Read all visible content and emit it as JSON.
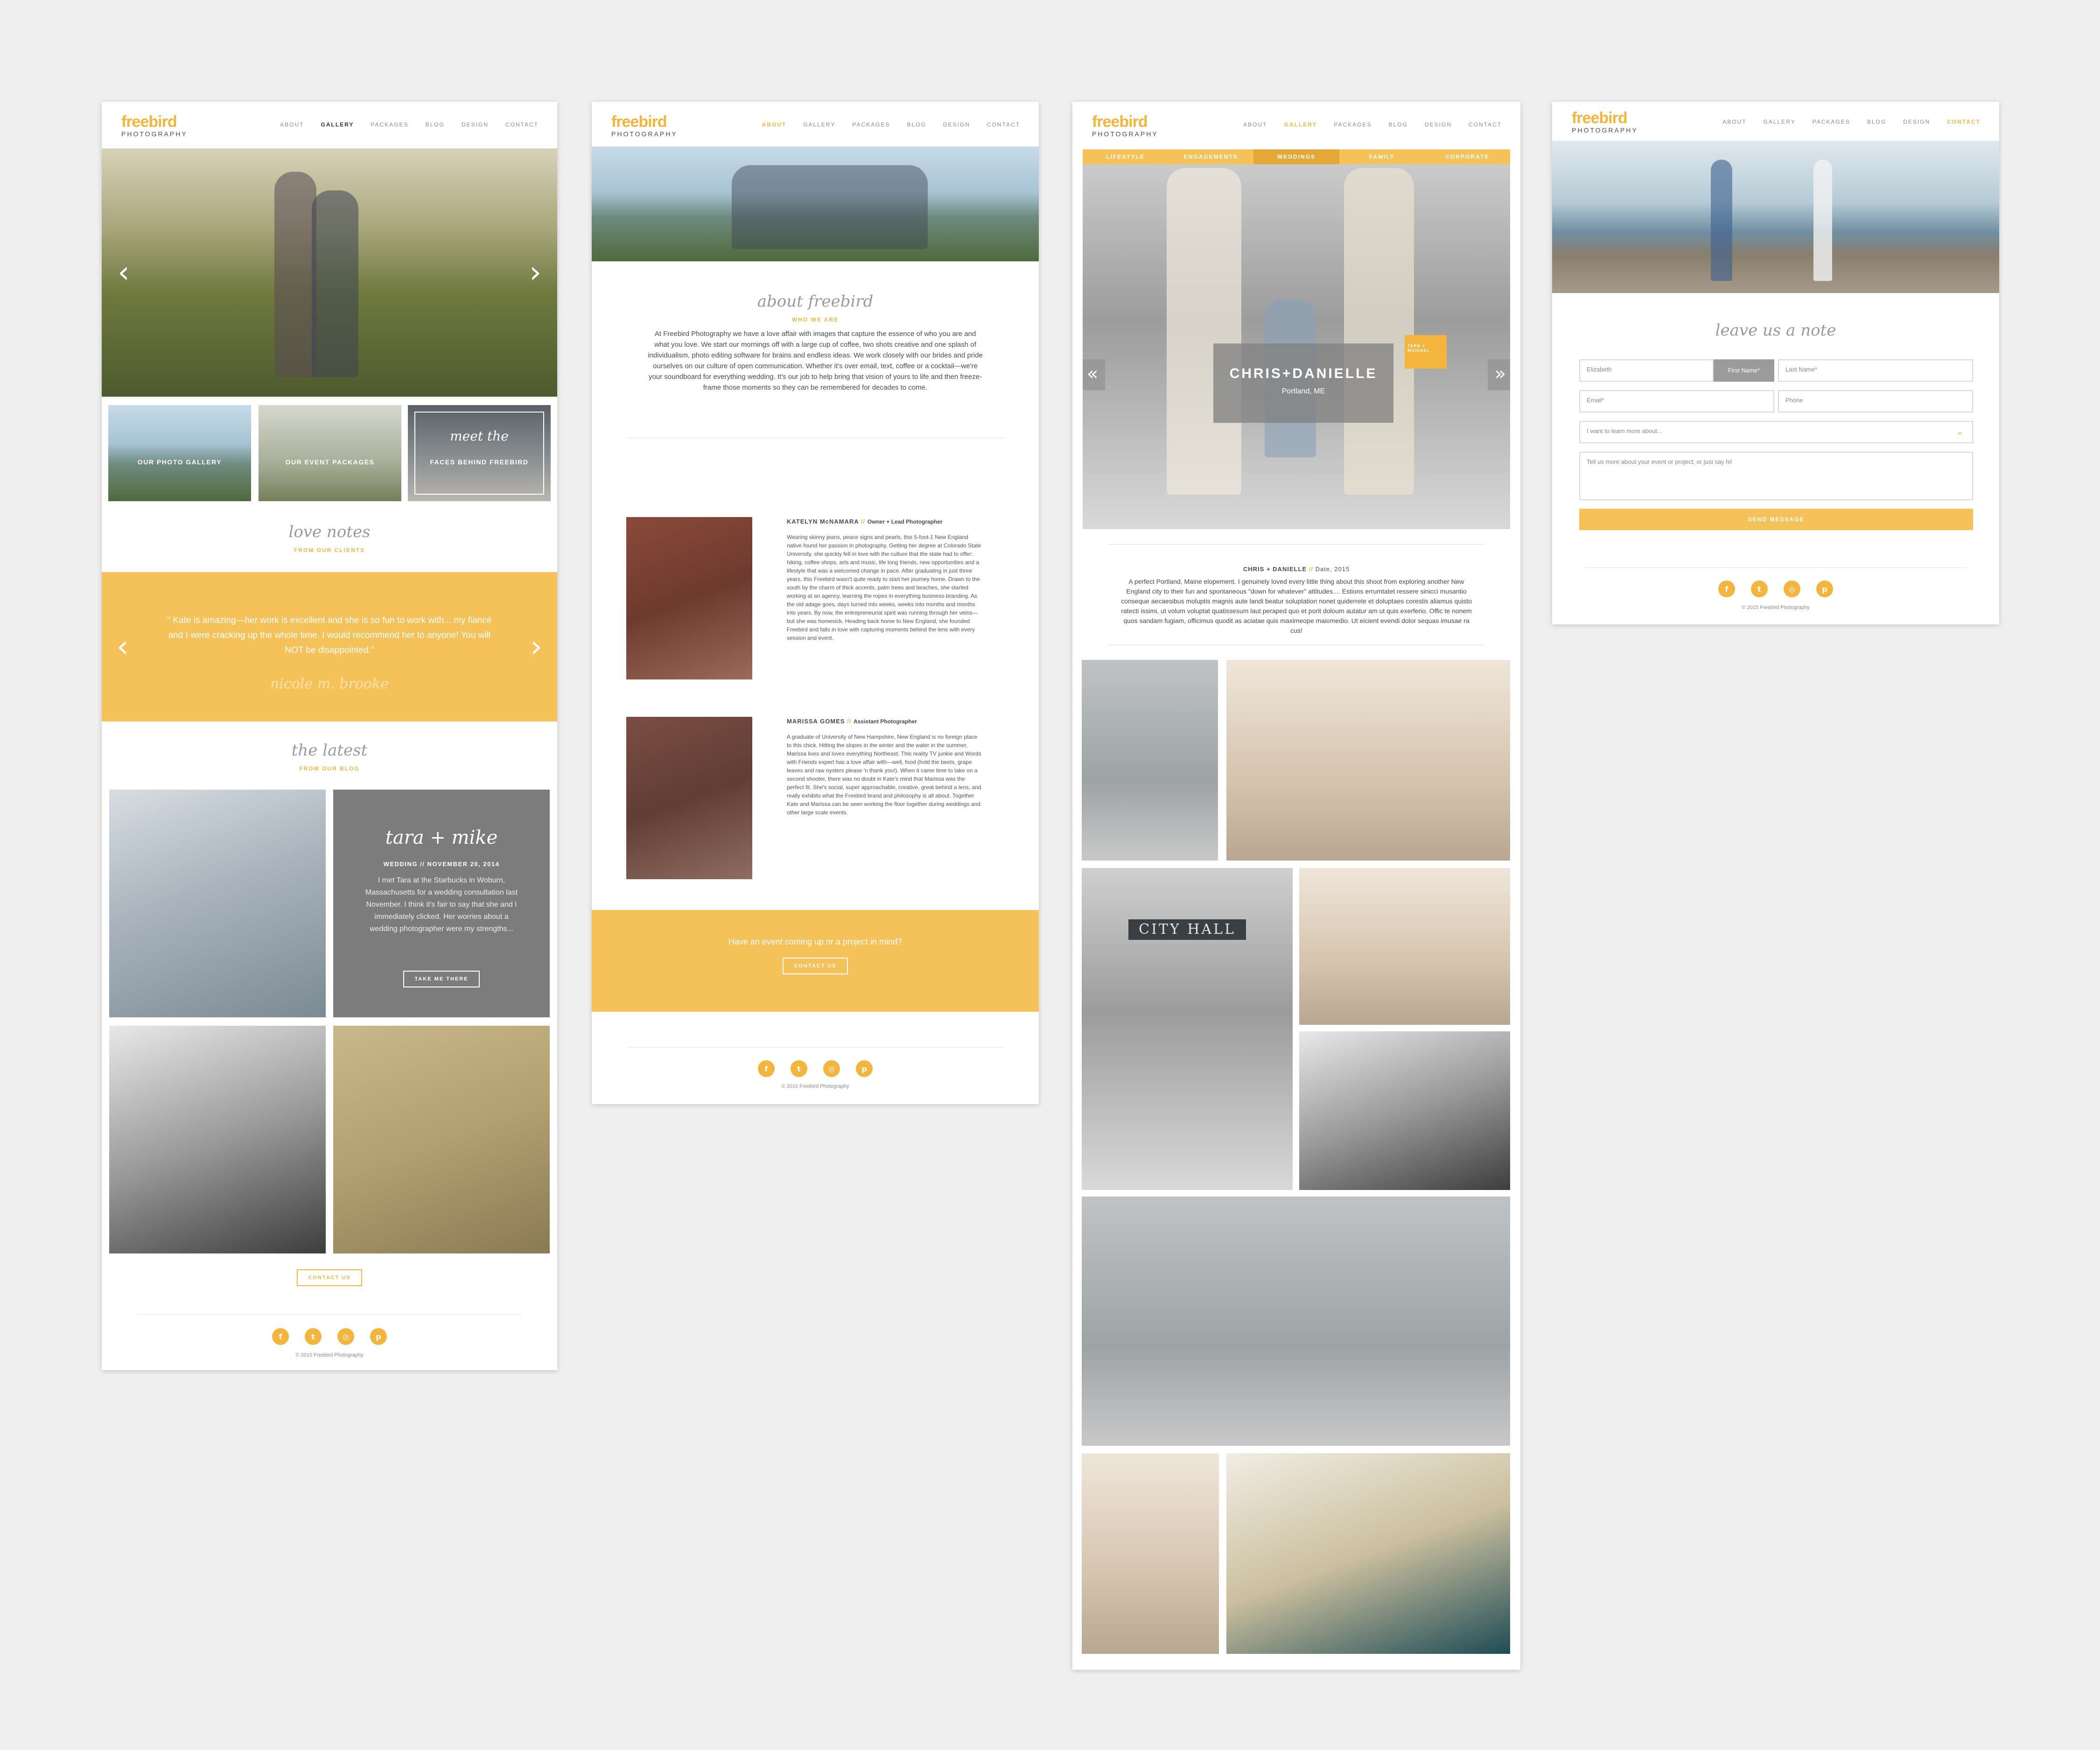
{
  "nav": {
    "logo_word": "freebird",
    "logo_sub": "PHOTOGRAPHY",
    "items": [
      "ABOUT",
      "GALLERY",
      "PACKAGES",
      "BLOG",
      "DESIGN",
      "CONTACT"
    ]
  },
  "home": {
    "tiles": [
      "OUR PHOTO GALLERY",
      "OUR EVENT PACKAGES",
      "FACES BEHIND FREEBIRD"
    ],
    "tile_scripts": [
      "",
      "",
      "meet the"
    ],
    "love_notes_script": "love notes",
    "love_notes_sub": "FROM OUR CLIENTS",
    "testimonial": "\" Kate is amazing—her work is excellent and she is so fun to work with... my fiancé and I were cracking up the whole time. I would recommend her to anyone! You will NOT be disappointed.\"",
    "testimonial_sig": "nicole m. brooke",
    "latest_script": "the latest",
    "latest_sub": "FROM OUR BLOG",
    "blog_post_script": "tara + mike",
    "blog_meta": "WEDDING // NOVEMBER 20, 2014",
    "blog_excerpt": "I met Tara at the Starbucks in Woburn, Massachusetts for a wedding consultation last November. I think it's fair to say that she and I immediately clicked. Her worries about a wedding photographer were my strengths...",
    "blog_button": "TAKE ME THERE",
    "contact_button": "CONTACT US",
    "copyright": "© 2015 Freebird Photography"
  },
  "about": {
    "script_title": "about freebird",
    "sub": "WHO WE ARE",
    "intro": "At Freebird Photography we have a love affair with images that capture the essence of who you are and what you love. We start our mornings off with a large cup of coffee, two shots creative and one splash of individualism, photo editing software for brains and endless ideas. We work closely with our brides and pride ourselves on our culture of open communication. Whether it's over email, text, coffee or a cocktail—we're your soundboard for everything wedding. It's our job to help bring that vision of yours to life and then freeze-frame those moments so they can be remembered for decades to come.",
    "person1_name": "KATELYN McNAMARA",
    "person1_role": "Owner + Lead Photographer",
    "person1_bio": "Wearing skinny jeans, peace signs and pearls, this 5-foot-1 New England native found her passion in photography. Getting her degree at Colorado State University, she quickly fell in love with the culture that the state had to offer: hiking, coffee shops, arts and music, life long friends, new opportunities and a lifestyle that was a welcomed change in pace. After graduating in just three years, this Freebird wasn't quite ready to start her journey home. Drawn to the south by the charm of thick accents, palm trees and beaches, she started working at an agency, learning the ropes in everything business-branding. As the old adage goes, days turned into weeks, weeks into months and months into years. By now, the entrepreneurial spirit was running through her veins—but she was homesick. Heading back home to New England, she founded Freebird and falls in love with capturing moments behind the lens with every session and event.",
    "person2_name": "MARISSA GOMES",
    "person2_role": "Assistant Photographer",
    "person2_bio": "A graduate of University of New Hampshire, New England is no foreign place to this chick. Hitting the slopes in the winter and the water in the summer, Marissa lives and loves everything Northeast. This reality TV junkie and Words with Friends expert has a love affair with—well, food (hold the beets, grape leaves and raw oysters please 'n thank you!). When it came time to take on a second shooter, there was no doubt in Kate's mind that Marissa was the perfect fit. She's social, super approachable, creative, great behind a lens, and really exhibits what the Freebird brand and philosophy is all about. Together Kate and Marissa can be seen working the floor together during weddings and other large scale events.",
    "cta_text": "Have an event coming up or a project in mind?",
    "cta_button": "CONTACT US",
    "copyright": "© 2015 Freebird Photography"
  },
  "gallery": {
    "tabs": [
      "LIFESTYLE",
      "ENGAGEMENTS",
      "WEDDINGS",
      "FAMILY",
      "CORPORATE"
    ],
    "active_tab": "WEDDINGS",
    "feature_title": "CHRIS+DANIELLE",
    "feature_location": "Portland, ME",
    "next_label": "TARA + MICHAEL",
    "post_title": "CHRIS + DANIELLE",
    "post_date": "Date, 2015",
    "post_body": "A perfect Portland, Maine elopement. I genuinely loved every little thing about this shoot from exploring another New England city to their fun and spontaneous \"down for whatever\" attitudes.... Estions errumtatet ressere sinicci musantio conseque aecaesibus moluptis magnis aute landi beatur soluptation nonet quiderrete et doluptaes corestis aliamus quisto ratecti issimi, ut volum voluptat quatissesum laut peraped quo et porit doloum autatur am ut quis exerferio. Offic te nonem quos sandam fugiam, officimus quodit as aciatae quis maximeope maiomedio. Ut eicient evendi dolor sequas imusae ra cus!",
    "city_hall": "CITY HALL",
    "copyright": "© 2015 Freebird Photography"
  },
  "contact": {
    "script_title": "leave us a note",
    "first_value": "Elizabeth",
    "first_tag": "First Name*",
    "last_placeholder": "Last Name*",
    "email_placeholder": "Email*",
    "phone_placeholder": "Phone",
    "select_value": "I want to learn more about...",
    "message_placeholder": "Tell us more about your event or project, or just say hi!",
    "send_button": "SEND MESSAGE",
    "copyright": "© 2015 Freebird Photography"
  },
  "colors": {
    "accent": "#f3b53e",
    "banner": "#f5c25a",
    "dark_tab": "#e3a838"
  },
  "icons": [
    "facebook-icon",
    "twitter-icon",
    "instagram-icon",
    "pinterest-icon"
  ]
}
